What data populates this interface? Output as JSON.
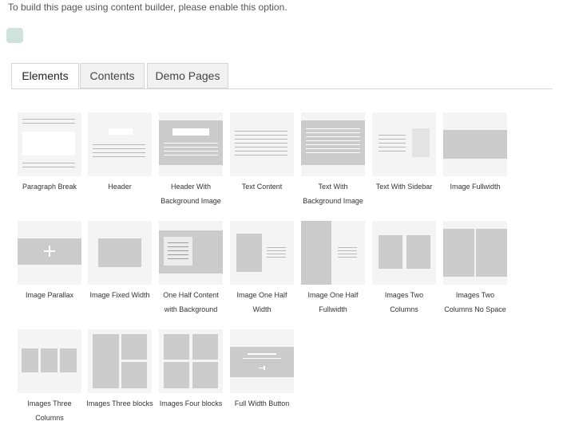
{
  "notice": "To build this page using content builder, please enable this option.",
  "tabs": [
    "Elements",
    "Contents",
    "Demo Pages"
  ],
  "elements": [
    {
      "line1": "Paragraph Break",
      "line2": ""
    },
    {
      "line1": "Header",
      "line2": ""
    },
    {
      "line1": "Header With",
      "line2": "Background Image"
    },
    {
      "line1": "Text Content",
      "line2": ""
    },
    {
      "line1": "Text With",
      "line2": "Background Image"
    },
    {
      "line1": "Text With Sidebar",
      "line2": ""
    },
    {
      "line1": "Image Fullwidth",
      "line2": ""
    },
    {
      "line1": "Image Parallax",
      "line2": ""
    },
    {
      "line1": "Image Fixed Width",
      "line2": ""
    },
    {
      "line1": "One Half Content",
      "line2": "with Background"
    },
    {
      "line1": "Image One Half",
      "line2": "Width"
    },
    {
      "line1": "Image One Half",
      "line2": "Fullwidth"
    },
    {
      "line1": "Images Two",
      "line2": "Columns"
    },
    {
      "line1": "Images Two",
      "line2": "Columns No Space"
    },
    {
      "line1": "Images Three",
      "line2": "Columns"
    },
    {
      "line1": "Images Three blocks",
      "line2": ""
    },
    {
      "line1": "Images Four blocks",
      "line2": ""
    },
    {
      "line1": "Full Width Button",
      "line2": ""
    }
  ]
}
